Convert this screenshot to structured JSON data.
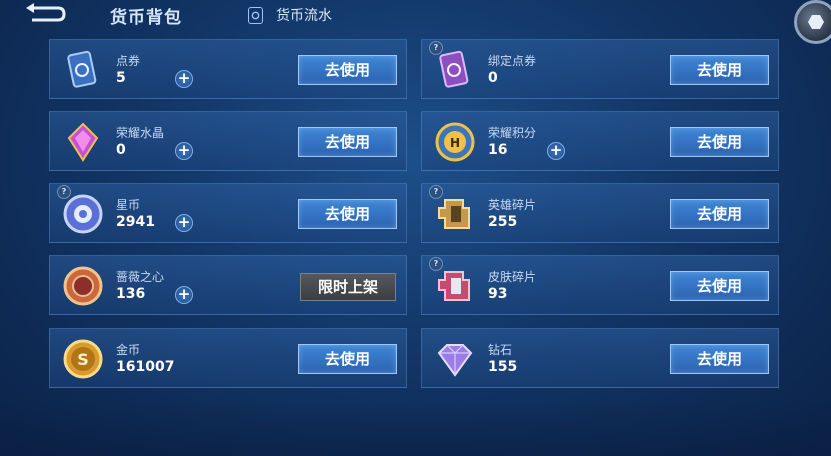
{
  "header": {
    "title": "货币背包",
    "flow_label": "货币流水"
  },
  "currencies": [
    {
      "name": "点券",
      "amount": "5",
      "action": "去使用",
      "icon": "ticket-card-icon"
    },
    {
      "name": "绑定点券",
      "amount": "0",
      "action": "去使用",
      "icon": "bound-ticket-icon"
    },
    {
      "name": "荣耀水晶",
      "amount": "0",
      "action": "去使用",
      "icon": "glory-crystal-icon"
    },
    {
      "name": "荣耀积分",
      "amount": "16",
      "action": "去使用",
      "icon": "glory-points-icon"
    },
    {
      "name": "星币",
      "amount": "2941",
      "action": "去使用",
      "icon": "star-coin-icon"
    },
    {
      "name": "英雄碎片",
      "amount": "255",
      "action": "去使用",
      "icon": "hero-fragment-icon"
    },
    {
      "name": "蔷薇之心",
      "amount": "136",
      "action": "限时上架",
      "icon": "rose-heart-icon"
    },
    {
      "name": "皮肤碎片",
      "amount": "93",
      "action": "去使用",
      "icon": "skin-fragment-icon"
    },
    {
      "name": "金币",
      "amount": "161007",
      "action": "去使用",
      "icon": "gold-coin-icon"
    },
    {
      "name": "钻石",
      "amount": "155",
      "action": "去使用",
      "icon": "diamond-icon"
    }
  ],
  "help_mark": "?",
  "plus_symbol": "+",
  "colors": {
    "background": "#123667",
    "use_button": "#3577c6",
    "limited_button": "#484b50"
  }
}
